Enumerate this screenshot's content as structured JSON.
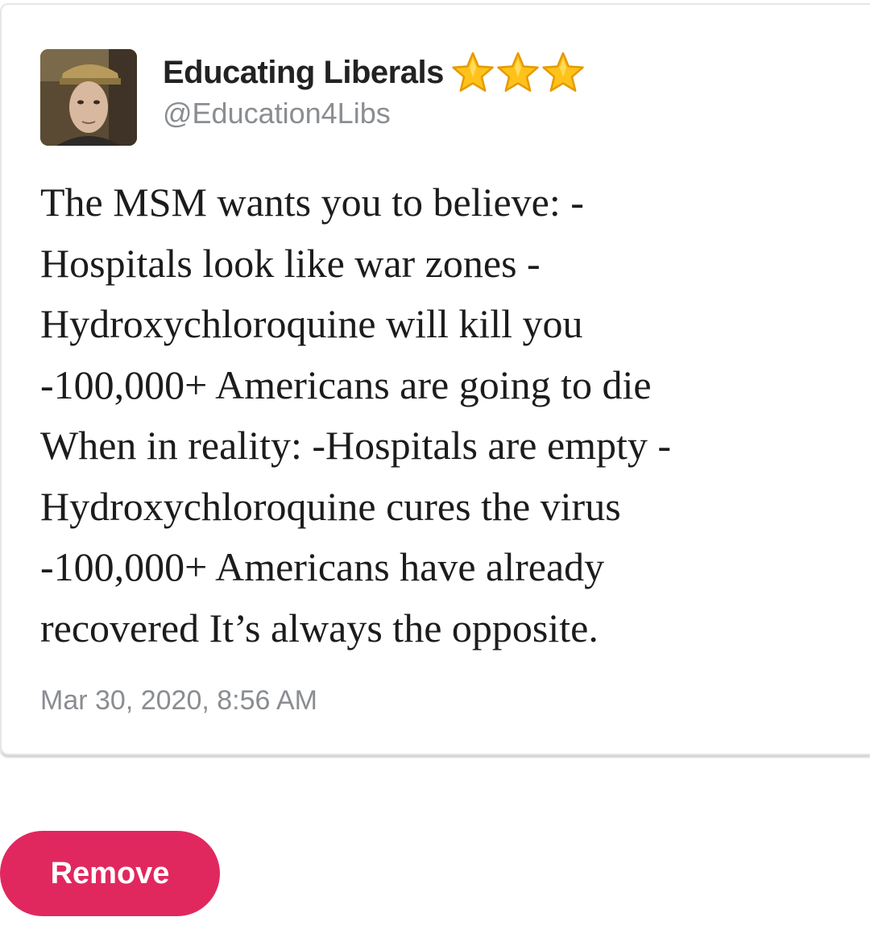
{
  "tweet": {
    "display_name": "Educating Liberals",
    "handle": "@Education4Libs",
    "badge_icons": [
      "star-icon",
      "star-icon",
      "star-icon"
    ],
    "text_lines": [
      "The MSM wants you to believe: -",
      "Hospitals look like war zones -",
      "Hydroxychloroquine will kill you",
      "-100,000+ Americans are going to die",
      "When in reality: -Hospitals are empty -",
      "Hydroxychloroquine cures the virus",
      "-100,000+ Americans have already",
      "recovered It’s always the opposite."
    ],
    "timestamp": "Mar 30, 2020, 8:56 AM"
  },
  "actions": {
    "remove_label": "Remove"
  },
  "colors": {
    "accent": "#e0285f",
    "secondary_text": "#8a8d91",
    "primary_text": "#222222",
    "star": "#ffc21a"
  }
}
